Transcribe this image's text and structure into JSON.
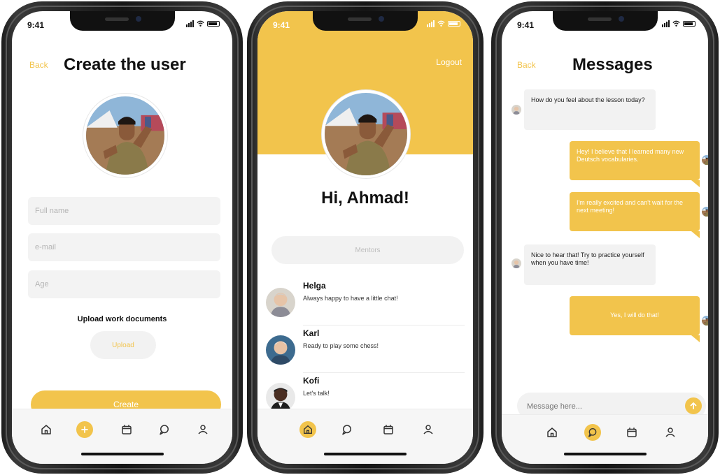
{
  "status": {
    "time": "9:41"
  },
  "create_screen": {
    "back_label": "Back",
    "title": "Create the user",
    "full_name_placeholder": "Full name",
    "email_placeholder": "e-mail",
    "age_placeholder": "Age",
    "upload_heading": "Upload work documents",
    "upload_button": "Upload",
    "create_button": "Create",
    "tabs": [
      "home-icon",
      "plus-icon",
      "calendar-icon",
      "chat-icon",
      "profile-icon"
    ],
    "active_tab": "plus-icon"
  },
  "profile_screen": {
    "logout_label": "Logout",
    "greeting": "Hi, Ahmad!",
    "mentors_tab": "Mentors",
    "mentors": [
      {
        "name": "Helga",
        "message": "Always happy to have a little chat!"
      },
      {
        "name": "Karl",
        "message": "Ready to play some chess!"
      },
      {
        "name": "Kofi",
        "message": "Let's talk!"
      }
    ],
    "tabs": [
      "home-icon",
      "chat-icon",
      "calendar-icon",
      "profile-icon"
    ],
    "active_tab": "home-icon"
  },
  "messages_screen": {
    "back_label": "Back",
    "title": "Messages",
    "messages": [
      {
        "from": "mentor",
        "text": "How do you feel about the lesson today?"
      },
      {
        "from": "user",
        "text": "Hey! I believe that I learned many new Deutsch vocabularies."
      },
      {
        "from": "user",
        "text": "I'm really excited and can't wait for the next meeting!"
      },
      {
        "from": "mentor",
        "text": "Nice to hear that! Try to practice yourself when you have time!"
      },
      {
        "from": "user",
        "text": "Yes, I will do that!"
      }
    ],
    "input_placeholder": "Message here...",
    "tabs": [
      "home-icon",
      "chat-icon",
      "calendar-icon",
      "profile-icon"
    ],
    "active_tab": "chat-icon"
  },
  "colors": {
    "accent": "#f2c44c",
    "field_bg": "#f3f3f3",
    "bubble_in": "#f2f2f2",
    "text": "#111111"
  }
}
